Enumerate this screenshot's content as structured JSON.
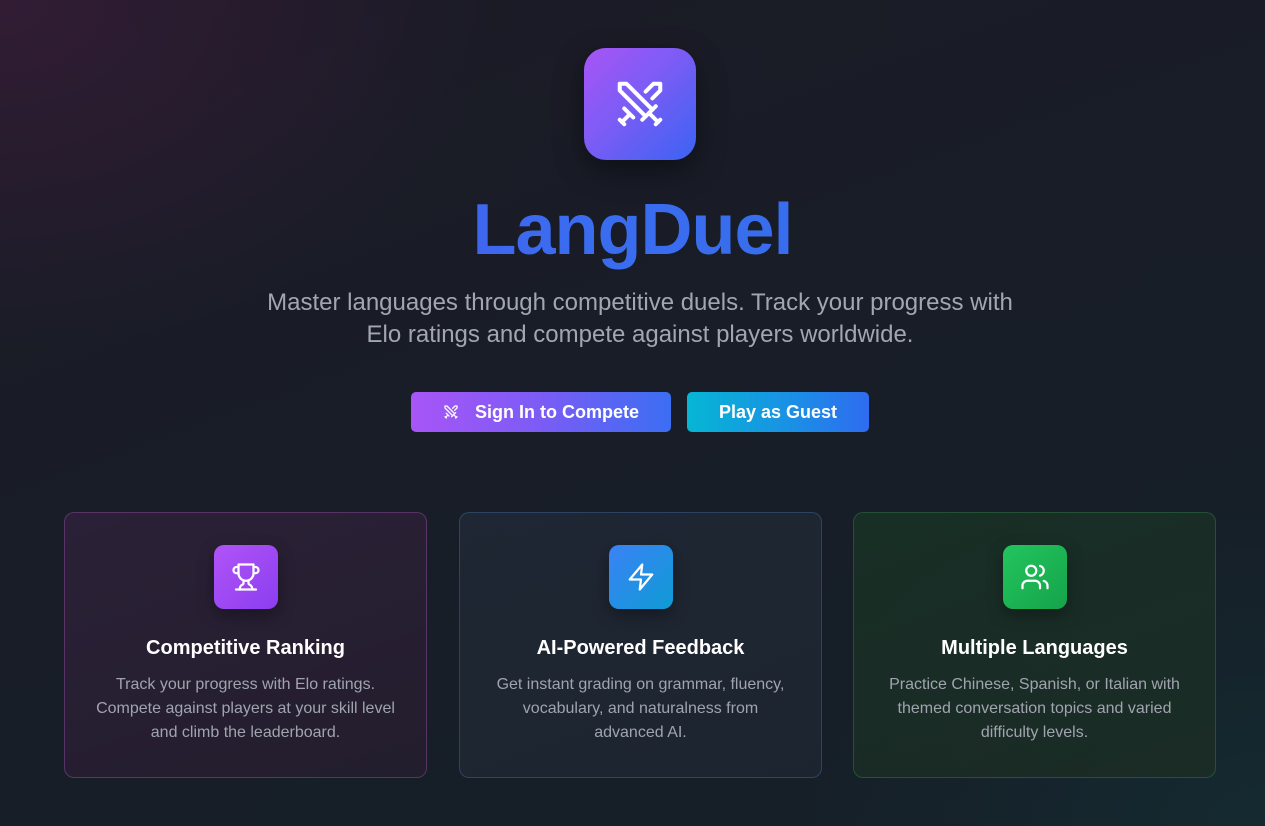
{
  "hero": {
    "logo_icon": "crossed-swords-icon",
    "title": "LangDuel",
    "subtitle": "Master languages through competitive duels. Track your progress with Elo ratings and compete against players worldwide."
  },
  "actions": {
    "sign_in_label": "Sign In to Compete",
    "sign_in_icon": "crossed-swords-icon",
    "guest_label": "Play as Guest"
  },
  "features": [
    {
      "icon": "trophy-icon",
      "title": "Competitive Ranking",
      "description": "Track your progress with Elo ratings. Compete against players at your skill level and climb the leaderboard."
    },
    {
      "icon": "lightning-icon",
      "title": "AI-Powered Feedback",
      "description": "Get instant grading on grammar, fluency, vocabulary, and naturalness from advanced AI."
    },
    {
      "icon": "users-icon",
      "title": "Multiple Languages",
      "description": "Practice Chinese, Spanish, or Italian with themed conversation topics and varied difficulty levels."
    }
  ],
  "colors": {
    "brand_purple": "#a855f7",
    "brand_blue": "#3b63f3",
    "guest_cyan": "#06b6d4",
    "feature_green": "#22c55e"
  }
}
